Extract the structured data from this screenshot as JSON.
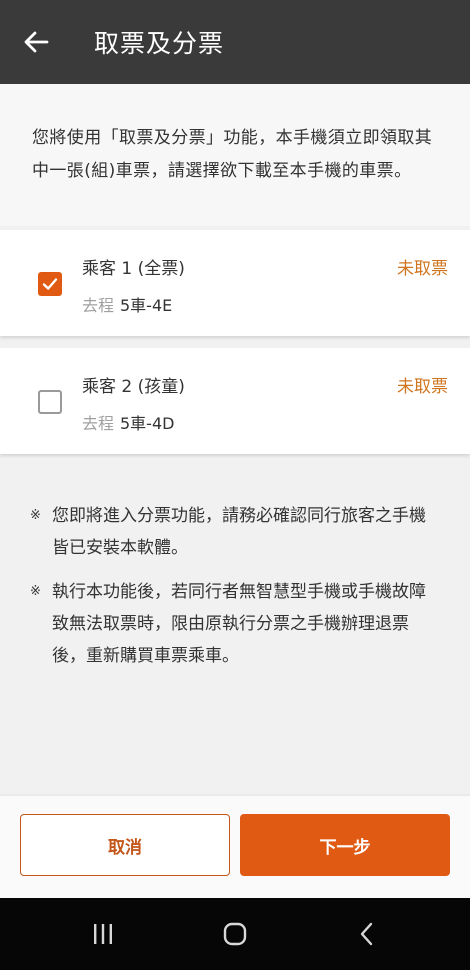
{
  "header": {
    "title": "取票及分票"
  },
  "intro": {
    "text": "您將使用「取票及分票」功能，本手機須立即領取其中一張(組)車票，請選擇欲下載至本手機的車票。"
  },
  "passengers": [
    {
      "name": "乘客 1 (全票)",
      "trip_label": "去程",
      "seat": "5車-4E",
      "status": "未取票",
      "checked": true
    },
    {
      "name": "乘客 2 (孩童)",
      "trip_label": "去程",
      "seat": "5車-4D",
      "status": "未取票",
      "checked": false
    }
  ],
  "notes": [
    {
      "mark": "※",
      "text": "您即將進入分票功能，請務必確認同行旅客之手機皆已安裝本軟體。"
    },
    {
      "mark": "※",
      "text": "執行本功能後，若同行者無智慧型手機或手機故障致無法取票時，限由原執行分票之手機辦理退票後，重新購買車票乘車。"
    }
  ],
  "buttons": {
    "cancel": "取消",
    "next": "下一步"
  },
  "colors": {
    "appbar": "#3a3a3a",
    "accent": "#e05a14",
    "status": "#d0751f"
  },
  "icons": {
    "back": "arrow-left",
    "check": "checkmark",
    "recents": "three-bars",
    "home": "rounded-square",
    "nav_back": "chevron-left"
  }
}
